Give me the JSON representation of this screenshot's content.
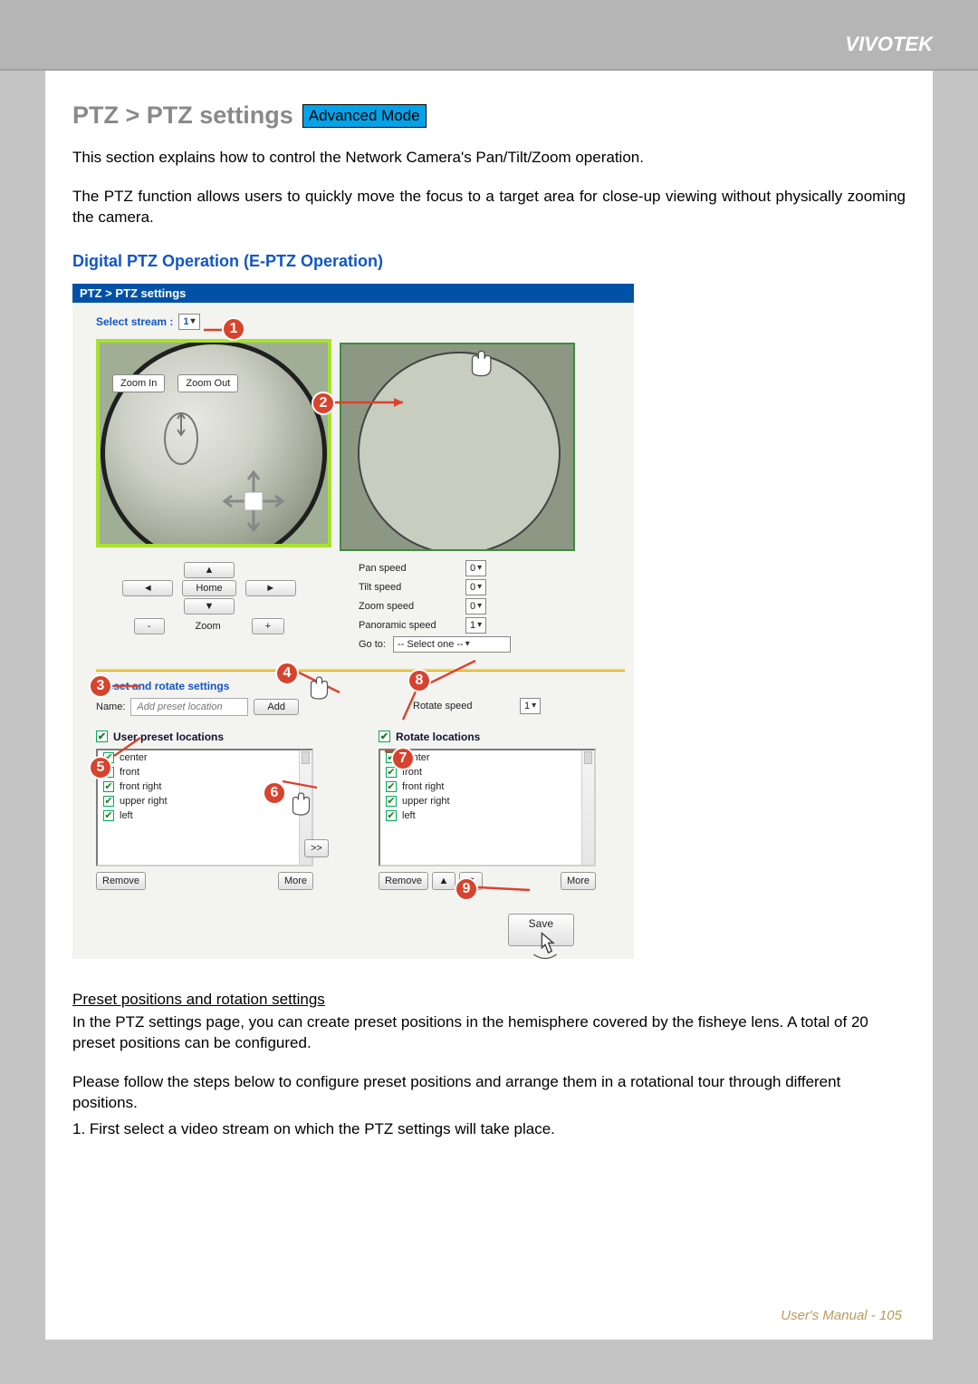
{
  "brand": "VIVOTEK",
  "title": "PTZ > PTZ settings",
  "mode_badge": "Advanced Mode",
  "intro1": "This section explains how to control the Network Camera's Pan/Tilt/Zoom operation.",
  "intro2": "The PTZ function allows users to quickly move the focus to a target area for close-up viewing without physically zooming the camera.",
  "sub_title": "Digital PTZ Operation (E-PTZ Operation)",
  "panel": {
    "bar": "PTZ  > PTZ settings",
    "select_stream_label": "Select stream :",
    "select_stream_value": "1",
    "zoom_in": "Zoom In",
    "zoom_out": "Zoom Out",
    "dir": {
      "up": "▲",
      "down": "▼",
      "left": "◄",
      "right": "►",
      "home": "Home",
      "minus": "-",
      "plus": "+",
      "zoom": "Zoom"
    },
    "speeds": {
      "pan": "Pan speed",
      "tilt": "Tilt speed",
      "zoom": "Zoom speed",
      "pano": "Panoramic speed",
      "pan_v": "0",
      "tilt_v": "0",
      "zoom_v": "0",
      "pano_v": "1",
      "goto": "Go to:",
      "goto_value": "-- Select one --",
      "rotate": "Rotate speed",
      "rotate_v": "1"
    },
    "preset": {
      "heading": "Preset and rotate settings",
      "name_label": "Name:",
      "name_placeholder": "Add preset location",
      "add": "Add"
    },
    "user_presets_title": "User preset locations",
    "rotate_locations_title": "Rotate locations",
    "items": [
      "center",
      "front",
      "front right",
      "upper right",
      "left"
    ],
    "transfer": ">>",
    "remove": "Remove",
    "more": "More",
    "reorder_up": "▲",
    "reorder_down": "▼",
    "save": "Save",
    "annot_video_num": "1"
  },
  "callouts": {
    "c1": "1",
    "c2": "2",
    "c3": "3",
    "c4": "4",
    "c5": "5",
    "c6": "6",
    "c7": "7",
    "c8": "8",
    "c9": "9"
  },
  "bottom": {
    "heading": "Preset positions and rotation settings",
    "p1": "In the PTZ settings page, you can create preset positions in the hemisphere covered by the fisheye lens. A total of 20 preset positions can be configured.",
    "p2": "Please follow the steps below to configure preset positions and arrange them in a rotational tour through different positions.",
    "p3": "1. First select a video stream on which the PTZ settings will take place."
  },
  "footer": "User's Manual - 105"
}
